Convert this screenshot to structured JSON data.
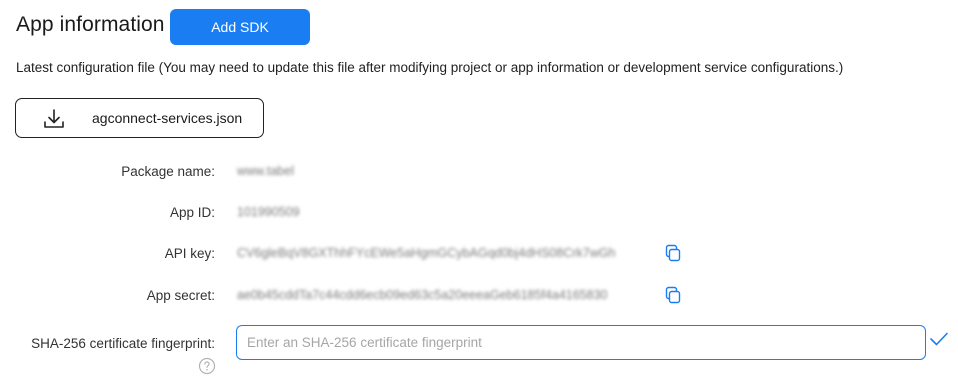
{
  "header": {
    "title": "App information",
    "add_sdk_label": "Add SDK"
  },
  "description": "Latest configuration file (You may need to update this file after modifying project or app information or development service configurations.)",
  "download": {
    "icon": "download-icon",
    "file_name": "agconnect-services.json"
  },
  "fields": {
    "package_name": {
      "label": "Package name:",
      "value": "www.t​abel"
    },
    "app_id": {
      "label": "App ID:",
      "value": "101990509"
    },
    "api_key": {
      "label": "API key:",
      "value": "CV6gleBqV8GXThhFYcEWe5aHgmGCybAGqd0bj4dHS08Crk7wGh",
      "icon": "copy-icon"
    },
    "app_secret": {
      "label": "App secret:",
      "value": "ae0b45cddTa7c44cdd6ecb09ed63c5a20eeeaGeb6185f4a4165830",
      "icon": "copy-icon"
    }
  },
  "sha": {
    "label": "SHA-256 certificate fingerprint:",
    "placeholder": "Enter an SHA-256 certificate fingerprint",
    "value": "",
    "help_icon": "help-icon",
    "confirm_icon": "check-icon"
  },
  "colors": {
    "accent": "#1a7ef2",
    "text": "#333333"
  }
}
